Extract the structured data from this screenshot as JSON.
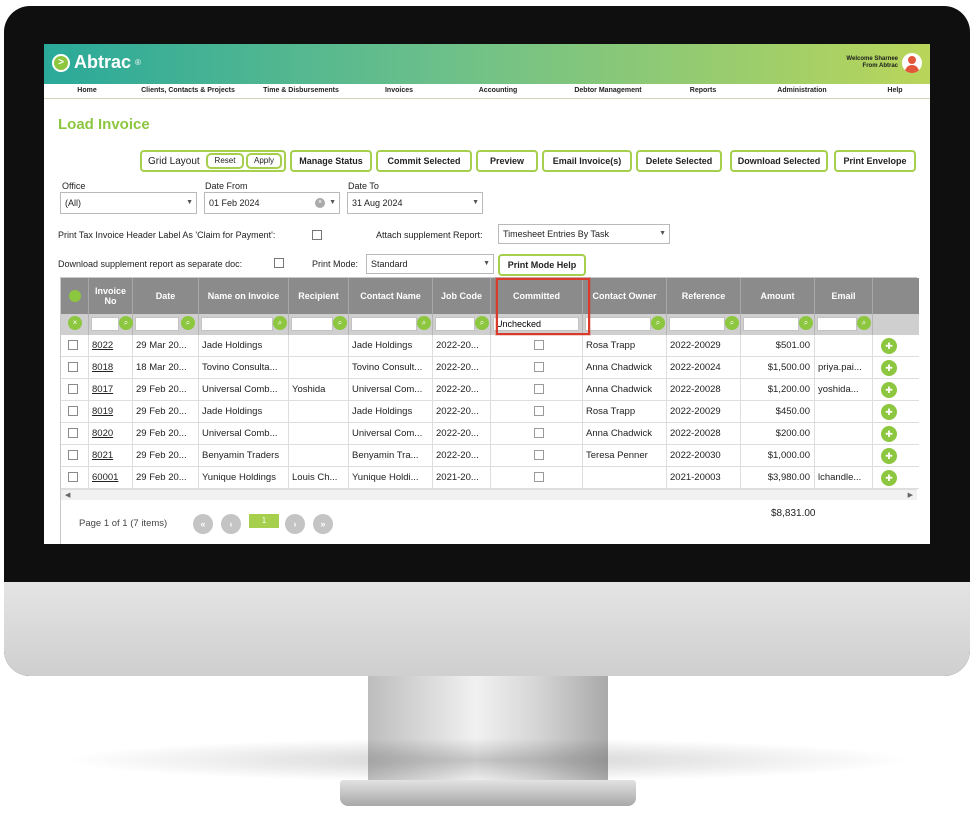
{
  "app": {
    "name": "Abtrac",
    "reg": "®",
    "welcome_line1": "Welcome Sharnee",
    "welcome_line2": "From Abtrac"
  },
  "nav": [
    "Home",
    "Clients, Contacts & Projects",
    "Time & Disbursements",
    "Invoices",
    "Accounting",
    "Debtor Management",
    "Reports",
    "Administration",
    "Help"
  ],
  "page_title": "Load Invoice",
  "toolbar": {
    "grid_layout": "Grid Layout",
    "reset": "Reset",
    "apply": "Apply",
    "manage_status": "Manage Status",
    "commit_selected": "Commit Selected",
    "preview": "Preview",
    "email_invoices": "Email Invoice(s)",
    "delete_selected": "Delete Selected",
    "download_selected": "Download Selected",
    "print_envelope": "Print Envelope"
  },
  "filters": {
    "office_label": "Office",
    "office_value": "(All)",
    "date_from_label": "Date From",
    "date_from_value": "01 Feb 2024",
    "date_to_label": "Date To",
    "date_to_value": "31 Aug 2024",
    "print_tax_label": "Print Tax Invoice Header Label As 'Claim for Payment':",
    "attach_label": "Attach supplement Report:",
    "attach_value": "Timesheet Entries By Task",
    "download_sep_label": "Download supplement report as separate doc:",
    "print_mode_label": "Print Mode:",
    "print_mode_value": "Standard",
    "print_mode_help": "Print Mode Help"
  },
  "grid": {
    "headers": [
      "Invoice No",
      "Date",
      "Name on Invoice",
      "Recipient",
      "Contact Name",
      "Job Code",
      "Committed",
      "Contact Owner",
      "Reference",
      "Amount",
      "Email"
    ],
    "committed_filter": "Unchecked",
    "rows": [
      {
        "no": "8022",
        "date": "29 Mar 20...",
        "name": "Jade Holdings",
        "recipient": "",
        "contact": "Jade Holdings",
        "job": "2022-20...",
        "owner": "Rosa Trapp",
        "ref": "2022-20029",
        "amount": "$501.00",
        "email": ""
      },
      {
        "no": "8018",
        "date": "18 Mar 20...",
        "name": "Tovino Consulta...",
        "recipient": "",
        "contact": "Tovino Consult...",
        "job": "2022-20...",
        "owner": "Anna Chadwick",
        "ref": "2022-20024",
        "amount": "$1,500.00",
        "email": "priya.pai..."
      },
      {
        "no": "8017",
        "date": "29 Feb 20...",
        "name": "Universal Comb...",
        "recipient": "Yoshida",
        "contact": "Universal Com...",
        "job": "2022-20...",
        "owner": "Anna Chadwick",
        "ref": "2022-20028",
        "amount": "$1,200.00",
        "email": "yoshida..."
      },
      {
        "no": "8019",
        "date": "29 Feb 20...",
        "name": "Jade Holdings",
        "recipient": "",
        "contact": "Jade Holdings",
        "job": "2022-20...",
        "owner": "Rosa Trapp",
        "ref": "2022-20029",
        "amount": "$450.00",
        "email": ""
      },
      {
        "no": "8020",
        "date": "29 Feb 20...",
        "name": "Universal Comb...",
        "recipient": "",
        "contact": "Universal Com...",
        "job": "2022-20...",
        "owner": "Anna Chadwick",
        "ref": "2022-20028",
        "amount": "$200.00",
        "email": ""
      },
      {
        "no": "8021",
        "date": "29 Feb 20...",
        "name": "Benyamin Traders",
        "recipient": "",
        "contact": "Benyamin Tra...",
        "job": "2022-20...",
        "owner": "Teresa Penner",
        "ref": "2022-20030",
        "amount": "$1,000.00",
        "email": ""
      },
      {
        "no": "60001",
        "date": "29 Feb 20...",
        "name": "Yunique Holdings",
        "recipient": "Louis Ch...",
        "contact": "Yunique Holdi...",
        "job": "2021-20...",
        "owner": "",
        "ref": "2021-20003",
        "amount": "$3,980.00",
        "email": "lchandle..."
      }
    ],
    "pager_text": "Page 1 of 1 (7 items)",
    "current_page": "1",
    "total": "$8,831.00"
  }
}
